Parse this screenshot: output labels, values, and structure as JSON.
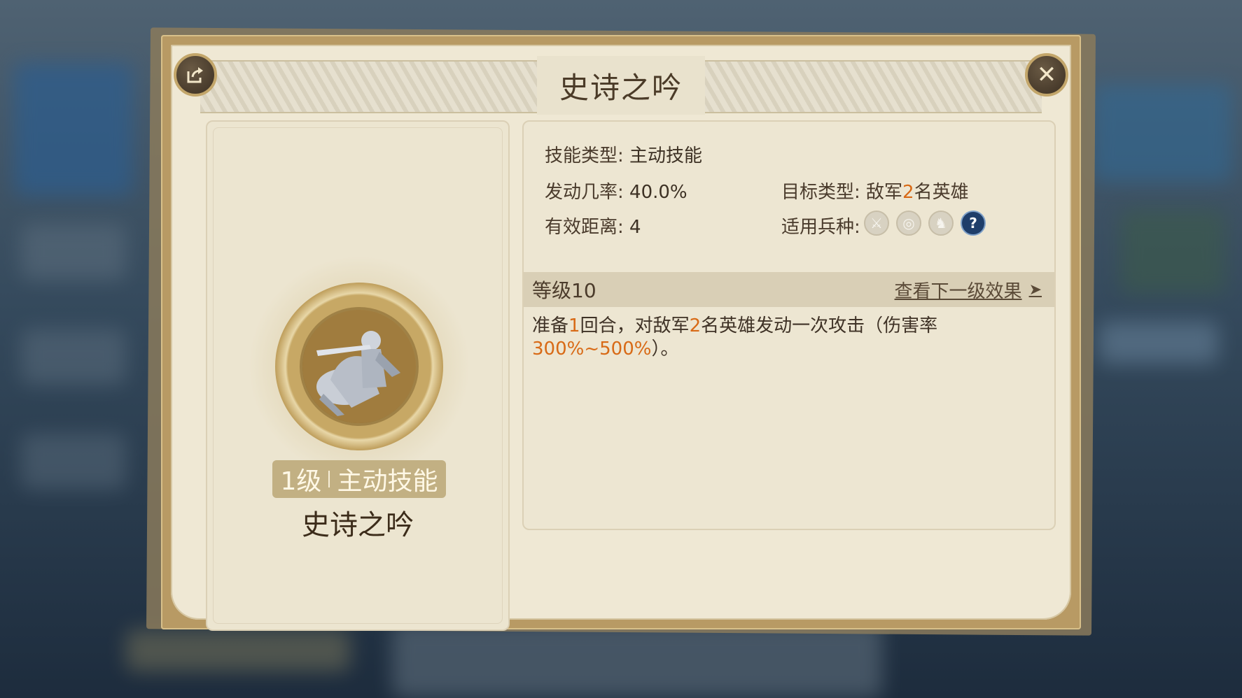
{
  "dialog": {
    "title": "史诗之吟"
  },
  "skill": {
    "level": "1级",
    "type_tag": "主动技能",
    "name": "史诗之吟"
  },
  "attributes": {
    "skill_type_label": "技能类型:",
    "skill_type_value": "主动技能",
    "trigger_rate_label": "发动几率:",
    "trigger_rate_value": "40.0%",
    "range_label": "有效距离:",
    "range_value": "4",
    "target_type_label": "目标类型:",
    "target_pre": "敌军",
    "target_count": "2",
    "target_post": "名英雄",
    "troops_label": "适用兵种:"
  },
  "troop_icons": [
    {
      "name": "sword-icon",
      "glyph": "⚔"
    },
    {
      "name": "target-icon",
      "glyph": "◎"
    },
    {
      "name": "horse-icon",
      "glyph": "♞"
    },
    {
      "name": "help-icon",
      "glyph": "?"
    }
  ],
  "level_info": {
    "level_label": "等级10",
    "next_level_link": "查看下一级效果",
    "arrow": "➤"
  },
  "description": {
    "p1": "准备",
    "prep_rounds": "1",
    "p2": "回合，对敌军",
    "target_count": "2",
    "p3": "名英雄发动一次攻击（伤害率",
    "damage_rate": "300%~500%",
    "p4": "）。"
  },
  "colors": {
    "highlight": "#d86a16",
    "parchment": "#efe8d4",
    "frame": "#b89a64"
  }
}
